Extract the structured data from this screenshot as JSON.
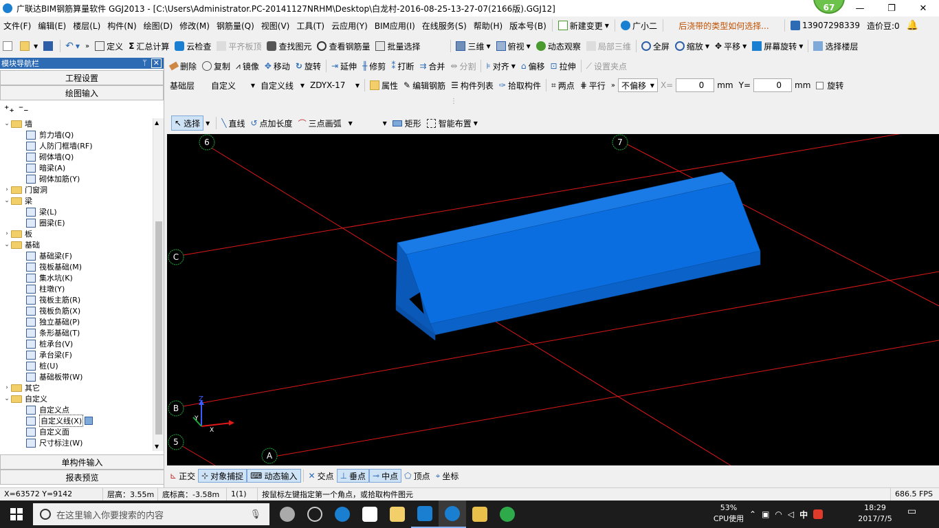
{
  "window": {
    "title": "广联达BIM钢筋算量软件 GGJ2013 - [C:\\Users\\Administrator.PC-20141127NRHM\\Desktop\\白龙村-2016-08-25-13-27-07(2166版).GGJ12]",
    "badge": "67",
    "min": "—",
    "restore": "❐",
    "close": "✕"
  },
  "menu": {
    "items": [
      "文件(F)",
      "编辑(E)",
      "楼层(L)",
      "构件(N)",
      "绘图(D)",
      "修改(M)",
      "钢筋量(Q)",
      "视图(V)",
      "工具(T)",
      "云应用(Y)",
      "BIM应用(I)",
      "在线服务(S)",
      "帮助(H)",
      "版本号(B)"
    ],
    "new_change": "新建变更",
    "guangxiaoer": "广小二",
    "tip": "后浇带的类型如何选择...",
    "phone": "13907298339",
    "price_bean": "造价豆:0"
  },
  "toolbar1": {
    "define": "定义",
    "sum_calc": "汇总计算",
    "cloud_check": "云检查",
    "flat_top": "平齐板顶",
    "find_elem": "查找图元",
    "view_steel": "查看钢筋量",
    "batch_select": "批量选择",
    "view3d": "三维",
    "topview": "俯视",
    "dynamic_view": "动态观察",
    "local3d": "局部三维",
    "fullscreen": "全屏",
    "zoom": "缩放",
    "pan": "平移",
    "rotate_screen": "屏幕旋转",
    "select_floor": "选择楼层"
  },
  "toolbar2": {
    "delete": "删除",
    "copy": "复制",
    "mirror": "镜像",
    "move": "移动",
    "rotate": "旋转",
    "extend": "延伸",
    "trim": "修剪",
    "break": "打断",
    "merge": "合并",
    "split": "分割",
    "align": "对齐",
    "offset": "偏移",
    "stretch": "拉伸",
    "set_grip": "设置夹点"
  },
  "toolbar3": {
    "layer": "基础层",
    "category": "自定义",
    "type": "自定义线",
    "name": "ZDYX-17",
    "property": "属性",
    "edit_steel": "编辑钢筋",
    "elem_list": "构件列表",
    "pick_elem": "拾取构件",
    "two_points": "两点",
    "parallel": "平行",
    "no_offset": "不偏移",
    "x_label": "X=",
    "x_val": "0",
    "mm1": "mm",
    "y_label": "Y=",
    "y_val": "0",
    "mm2": "mm",
    "rotate_chk": "旋转"
  },
  "draw_toolbar": {
    "select": "选择",
    "line": "直线",
    "point_len": "点加长度",
    "arc3": "三点画弧",
    "rect": "矩形",
    "smart_layout": "智能布置"
  },
  "left_panel": {
    "title": "模块导航栏",
    "pin": "ᛘ",
    "close": "✕",
    "project_settings": "工程设置",
    "drawing_input": "绘图输入",
    "single_input": "单构件输入",
    "report_preview": "报表预览",
    "tree": [
      {
        "level": 0,
        "toggle": "⌄",
        "label": "墙",
        "folder": true
      },
      {
        "level": 1,
        "label": "剪力墙(Q)",
        "icon": "shear-wall-icon"
      },
      {
        "level": 1,
        "label": "人防门框墙(RF)",
        "icon": "civil-door-wall-icon"
      },
      {
        "level": 1,
        "label": "砌体墙(Q)",
        "icon": "masonry-wall-icon"
      },
      {
        "level": 1,
        "label": "暗梁(A)",
        "icon": "hidden-beam-icon"
      },
      {
        "level": 1,
        "label": "砌体加筋(Y)",
        "icon": "masonry-rebar-icon"
      },
      {
        "level": 0,
        "toggle": "›",
        "label": "门窗洞",
        "folder": true
      },
      {
        "level": 0,
        "toggle": "⌄",
        "label": "梁",
        "folder": true
      },
      {
        "level": 1,
        "label": "梁(L)",
        "icon": "beam-icon"
      },
      {
        "level": 1,
        "label": "圈梁(E)",
        "icon": "ring-beam-icon"
      },
      {
        "level": 0,
        "toggle": "›",
        "label": "板",
        "folder": true
      },
      {
        "level": 0,
        "toggle": "⌄",
        "label": "基础",
        "folder": true
      },
      {
        "level": 1,
        "label": "基础梁(F)",
        "icon": "foundation-beam-icon"
      },
      {
        "level": 1,
        "label": "筏板基础(M)",
        "icon": "raft-foundation-icon"
      },
      {
        "level": 1,
        "label": "集水坑(K)",
        "icon": "sump-pit-icon"
      },
      {
        "level": 1,
        "label": "柱墩(Y)",
        "icon": "column-pier-icon"
      },
      {
        "level": 1,
        "label": "筏板主筋(R)",
        "icon": "raft-main-bar-icon"
      },
      {
        "level": 1,
        "label": "筏板负筋(X)",
        "icon": "raft-negative-bar-icon"
      },
      {
        "level": 1,
        "label": "独立基础(P)",
        "icon": "isolated-footing-icon"
      },
      {
        "level": 1,
        "label": "条形基础(T)",
        "icon": "strip-footing-icon"
      },
      {
        "level": 1,
        "label": "桩承台(V)",
        "icon": "pile-cap-icon"
      },
      {
        "level": 1,
        "label": "承台梁(F)",
        "icon": "cap-beam-icon"
      },
      {
        "level": 1,
        "label": "桩(U)",
        "icon": "pile-icon"
      },
      {
        "level": 1,
        "label": "基础板带(W)",
        "icon": "foundation-strip-icon"
      },
      {
        "level": 0,
        "toggle": "›",
        "label": "其它",
        "folder": true
      },
      {
        "level": 0,
        "toggle": "⌄",
        "label": "自定义",
        "folder": true
      },
      {
        "level": 1,
        "label": "自定义点",
        "icon": "custom-point-icon"
      },
      {
        "level": 1,
        "label": "自定义线(X)",
        "icon": "custom-line-icon",
        "selected": true
      },
      {
        "level": 1,
        "label": "自定义面",
        "icon": "custom-face-icon"
      },
      {
        "level": 1,
        "label": "尺寸标注(W)",
        "icon": "dimension-icon"
      }
    ]
  },
  "canvas": {
    "axes": [
      "6",
      "7",
      "C",
      "B",
      "5",
      "A"
    ],
    "object_color": "#0a6ee0",
    "grid_color": "#e01818",
    "axis_circle_color": "#1fae3a"
  },
  "snap_bar": {
    "ortho": "正交",
    "obj_snap": "对象捕捉",
    "dyn_input": "动态输入",
    "intersection": "交点",
    "perpendicular": "垂点",
    "midpoint": "中点",
    "vertex": "顶点",
    "coordinate": "坐标"
  },
  "status_bar": {
    "coords": "X=63572 Y=9142",
    "floor_height": "层高：3.55m",
    "bottom_elev": "底标高：-3.58m",
    "count": "1(1)",
    "hint": "按鼠标左键指定第一个角点，或拾取构件图元",
    "fps": "686.5 FPS"
  },
  "taskbar": {
    "search_placeholder": "在这里输入你要搜索的内容",
    "cpu_pct": "53%",
    "cpu_label": "CPU使用",
    "ime": "中",
    "time": "18:29",
    "date": "2017/7/5"
  }
}
